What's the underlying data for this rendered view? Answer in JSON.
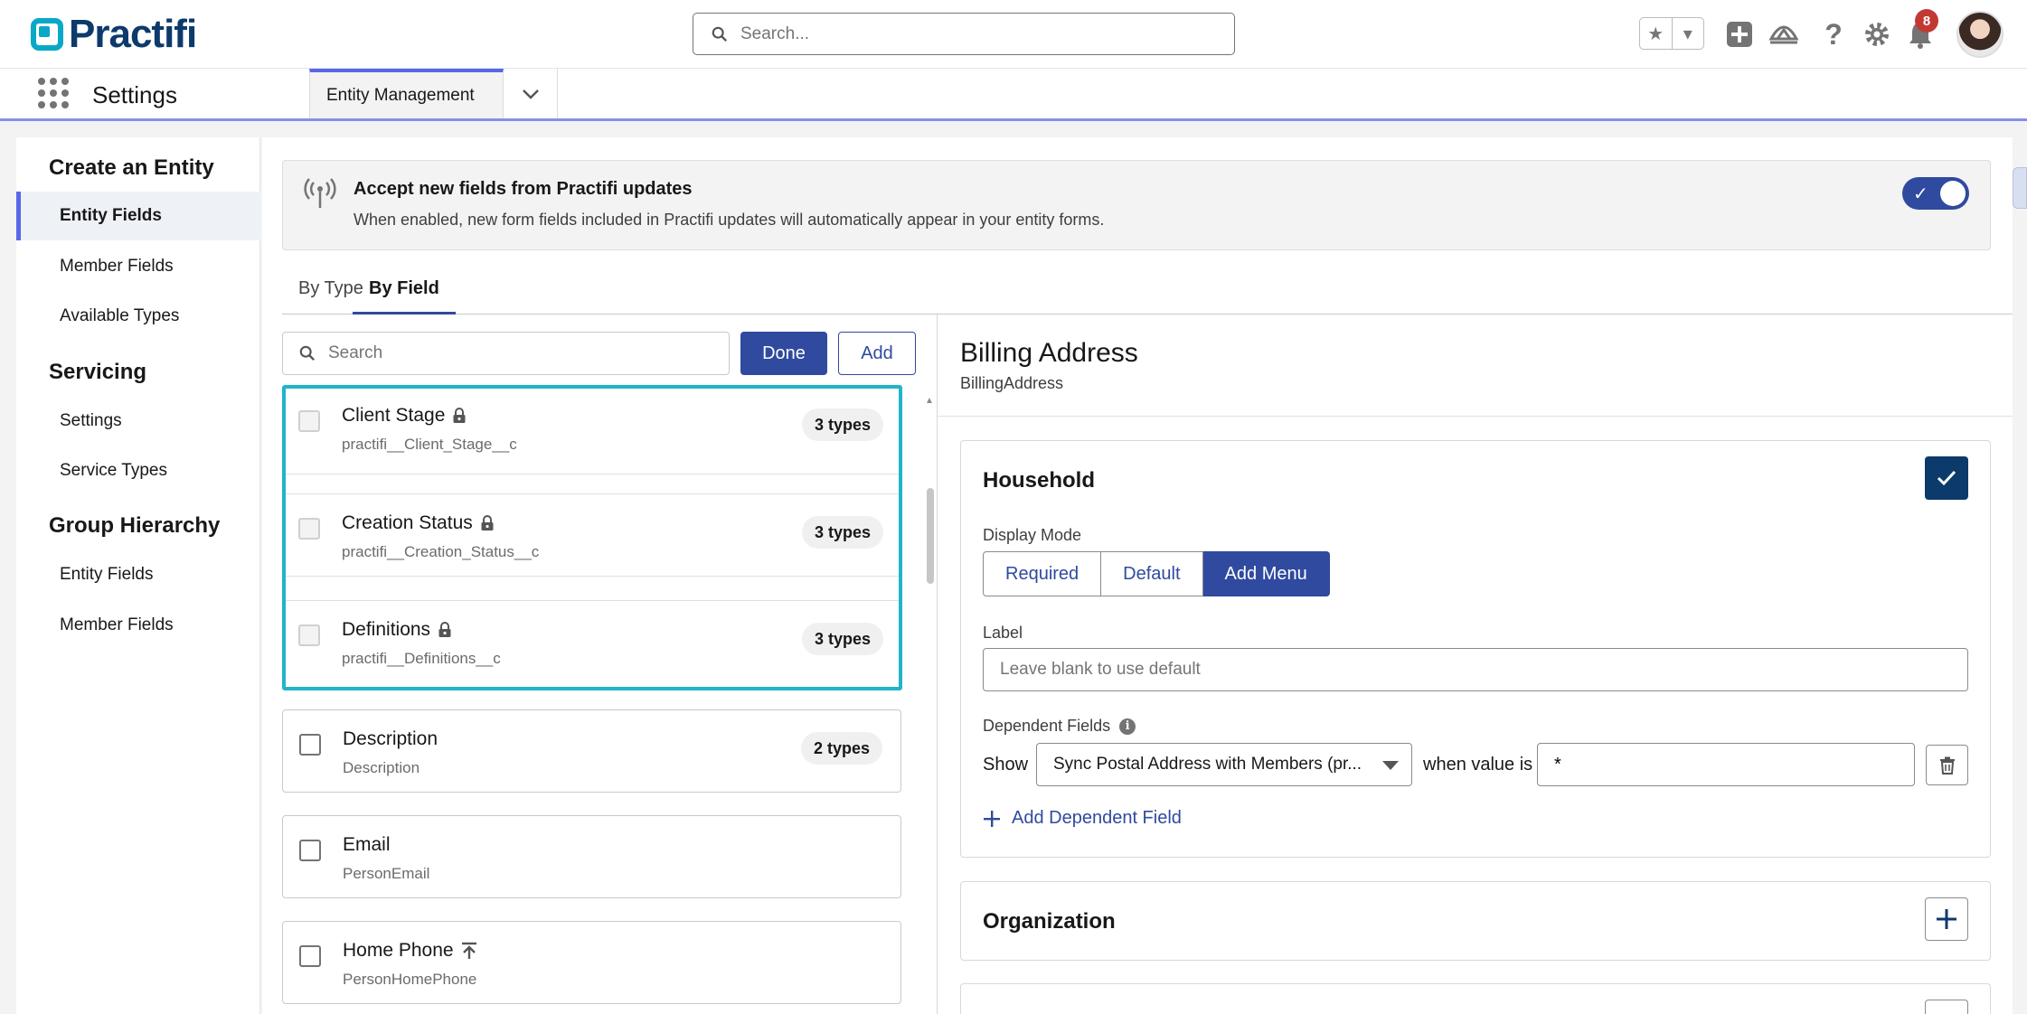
{
  "app": {
    "brand": "Practifi",
    "name": "Settings"
  },
  "header": {
    "search_placeholder": "Search...",
    "notification_count": "8"
  },
  "nav": {
    "tab_label": "Entity Management"
  },
  "sidebar": {
    "sections": [
      {
        "title": "Create an Entity",
        "items": [
          "Entity Fields",
          "Member Fields",
          "Available Types"
        ]
      },
      {
        "title": "Servicing",
        "items": [
          "Settings",
          "Service Types"
        ]
      },
      {
        "title": "Group Hierarchy",
        "items": [
          "Entity Fields",
          "Member Fields"
        ]
      }
    ],
    "active_item": "Entity Fields"
  },
  "banner": {
    "title": "Accept new fields from Practifi updates",
    "description": "When enabled, new form fields included in Practifi updates will automatically appear in your entity forms.",
    "enabled": true
  },
  "tabs": [
    {
      "label": "By Type",
      "active": false
    },
    {
      "label": "By Field",
      "active": true
    }
  ],
  "field_list": {
    "search_placeholder": "Search",
    "done_label": "Done",
    "add_label": "Add",
    "fields": [
      {
        "name": "Client Stage",
        "api": "practifi__Client_Stage__c",
        "types": "3 types",
        "icon": "lock-icon",
        "selected": true
      },
      {
        "name": "Creation Status",
        "api": "practifi__Creation_Status__c",
        "types": "3 types",
        "icon": "lock-icon",
        "selected": true
      },
      {
        "name": "Definitions",
        "api": "practifi__Definitions__c",
        "types": "3 types",
        "icon": "lock-icon",
        "selected": true
      },
      {
        "name": "Description",
        "api": "Description",
        "types": "2 types",
        "icon": "",
        "selected": false
      },
      {
        "name": "Email",
        "api": "PersonEmail",
        "types": "",
        "icon": "",
        "selected": false
      },
      {
        "name": "Home Phone",
        "api": "PersonHomePhone",
        "types": "",
        "icon": "upload-icon",
        "selected": false
      }
    ]
  },
  "detail": {
    "title": "Billing Address",
    "api_name": "BillingAddress",
    "household": {
      "title": "Household",
      "display_mode_label": "Display Mode",
      "modes": [
        "Required",
        "Default",
        "Add Menu"
      ],
      "active_mode": "Add Menu",
      "label_label": "Label",
      "label_placeholder": "Leave blank to use default",
      "dependent_label": "Dependent Fields",
      "show_text": "Show",
      "dependent_field": "Sync Postal Address with Members (pr...",
      "when_text": "when value is",
      "value": "*",
      "add_dependent": "Add Dependent Field"
    },
    "organization": {
      "title": "Organization"
    }
  },
  "colors": {
    "brand": "#2f4a9e",
    "accent_cyan": "#20b5c9",
    "nav_accent": "#5867e8"
  }
}
